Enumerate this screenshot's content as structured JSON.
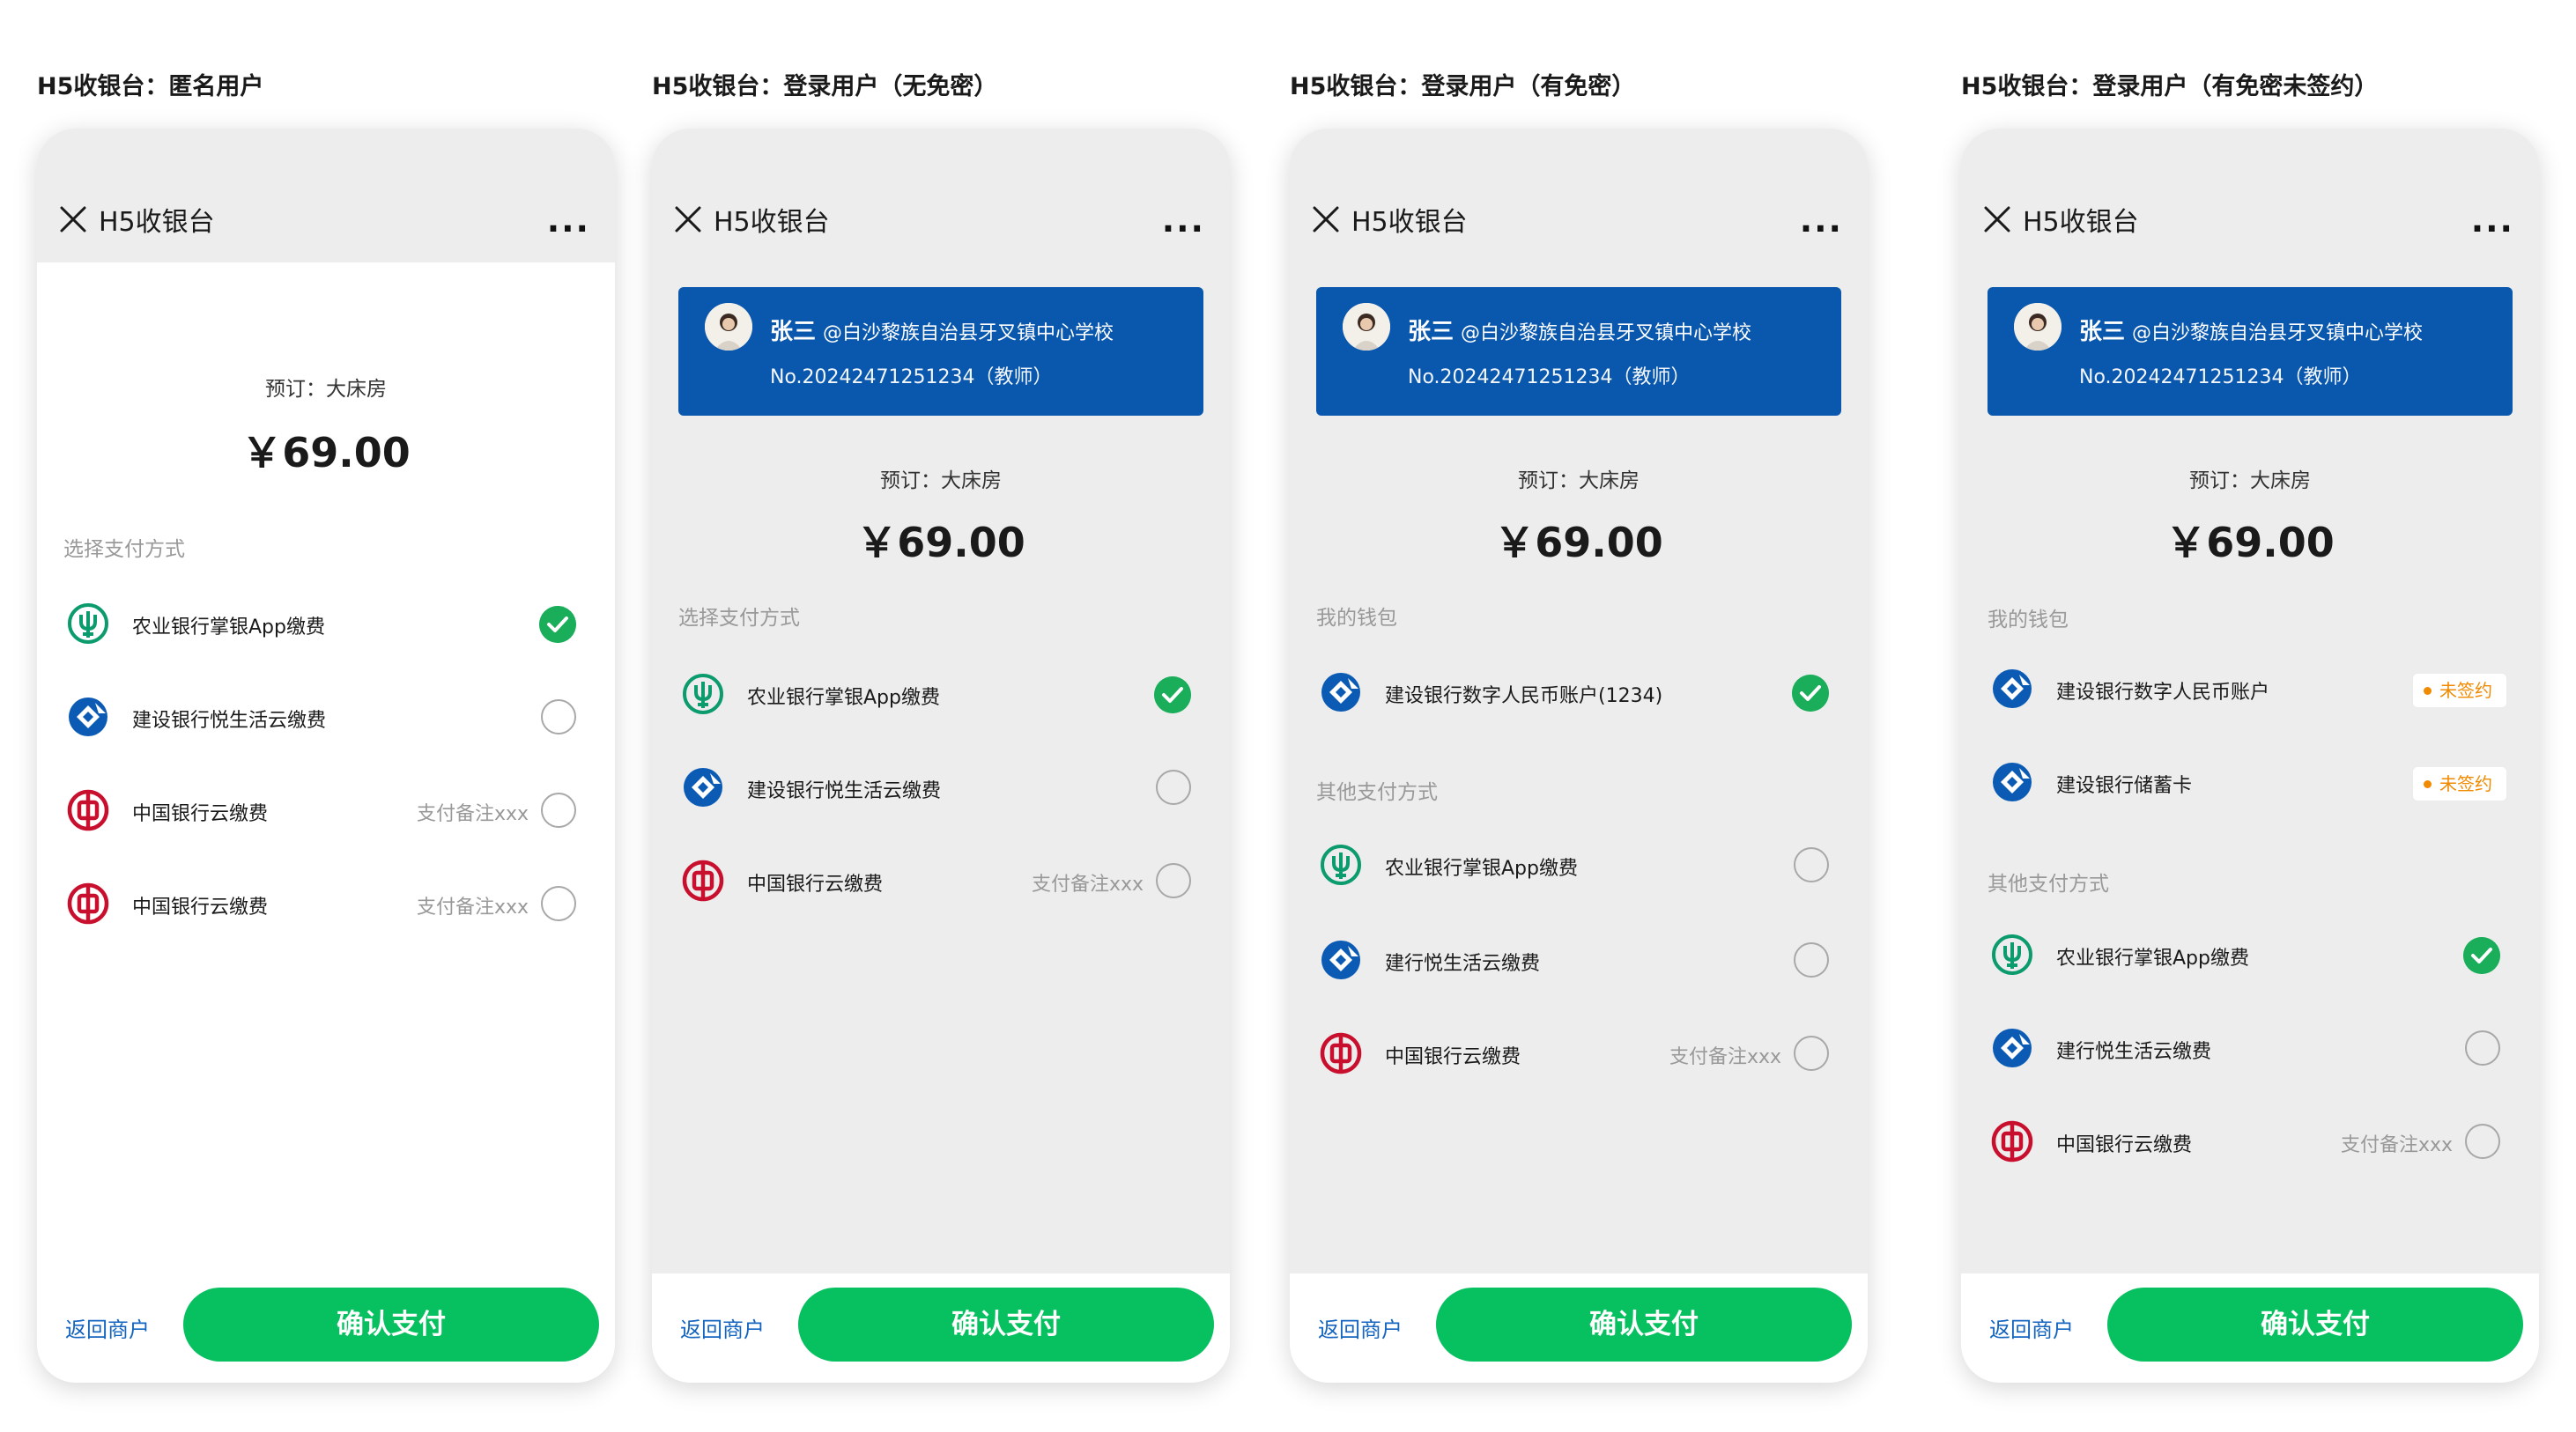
{
  "nav": {
    "title": "H5收银台",
    "more": "..."
  },
  "common": {
    "order_label": "预订：大床房",
    "amount": "￥69.00",
    "back_link": "返回商户",
    "confirm_button": "确认支付",
    "pay_note": "支付备注xxx",
    "unsigned_badge": "未签约"
  },
  "user": {
    "name": "张三",
    "school": "@白沙黎族自治县牙叉镇中心学校",
    "number": "No.20242471251234（教师）"
  },
  "colors": {
    "brand_green": "#07c160",
    "check_green": "#1aad5a",
    "user_card_blue": "#0a57ae",
    "link_blue": "#1565c0",
    "warning_orange": "#f08a00",
    "abc_green": "#0c9b6d",
    "ccb_blue": "#0b5bb5",
    "boc_red": "#c8102e"
  },
  "panels": [
    {
      "title": "H5收银台：匿名用户",
      "section_pay": "选择支付方式",
      "methods": [
        {
          "icon": "abc-bank-icon",
          "label": "农业银行掌银App缴费",
          "state": "checked"
        },
        {
          "icon": "ccb-bank-icon",
          "label": "建设银行悦生活云缴费",
          "state": "unchecked"
        },
        {
          "icon": "boc-bank-icon",
          "label": "中国银行云缴费",
          "note": "支付备注xxx",
          "state": "unchecked"
        },
        {
          "icon": "boc-bank-icon",
          "label": "中国银行云缴费",
          "note": "支付备注xxx",
          "state": "unchecked"
        }
      ]
    },
    {
      "title": "H5收银台：登录用户（无免密）",
      "section_pay": "选择支付方式",
      "methods": [
        {
          "icon": "abc-bank-icon",
          "label": "农业银行掌银App缴费",
          "state": "checked"
        },
        {
          "icon": "ccb-bank-icon",
          "label": "建设银行悦生活云缴费",
          "state": "unchecked"
        },
        {
          "icon": "boc-bank-icon",
          "label": "中国银行云缴费",
          "note": "支付备注xxx",
          "state": "unchecked"
        }
      ]
    },
    {
      "title": "H5收银台：登录用户（有免密）",
      "section_wallet": "我的钱包",
      "wallet": [
        {
          "icon": "ccb-bank-icon",
          "label": "建设银行数字人民币账户(1234)",
          "state": "checked"
        }
      ],
      "section_other": "其他支付方式",
      "methods": [
        {
          "icon": "abc-bank-icon",
          "label": "农业银行掌银App缴费",
          "state": "unchecked"
        },
        {
          "icon": "ccb-bank-icon",
          "label": "建行悦生活云缴费",
          "state": "unchecked"
        },
        {
          "icon": "boc-bank-icon",
          "label": "中国银行云缴费",
          "note": "支付备注xxx",
          "state": "unchecked"
        }
      ]
    },
    {
      "title": "H5收银台：登录用户（有免密未签约）",
      "section_wallet": "我的钱包",
      "wallet": [
        {
          "icon": "ccb-bank-icon",
          "label": "建设银行数字人民币账户",
          "badge": "未签约"
        },
        {
          "icon": "ccb-bank-icon",
          "label": "建设银行储蓄卡",
          "badge": "未签约"
        }
      ],
      "section_other": "其他支付方式",
      "methods": [
        {
          "icon": "abc-bank-icon",
          "label": "农业银行掌银App缴费",
          "state": "checked"
        },
        {
          "icon": "ccb-bank-icon",
          "label": "建行悦生活云缴费",
          "state": "unchecked"
        },
        {
          "icon": "boc-bank-icon",
          "label": "中国银行云缴费",
          "note": "支付备注xxx",
          "state": "unchecked"
        }
      ]
    }
  ]
}
